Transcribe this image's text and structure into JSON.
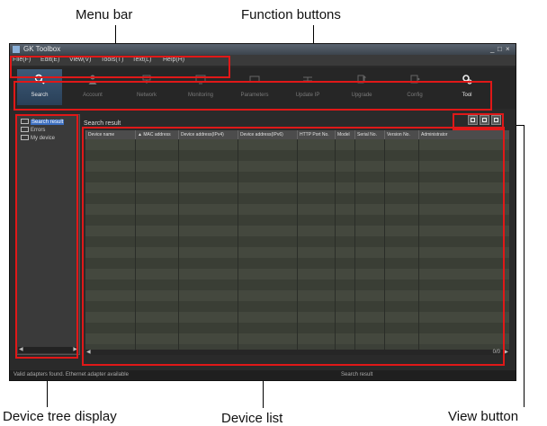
{
  "annotations": {
    "menu_bar": "Menu bar",
    "function_buttons": "Function buttons",
    "device_tree_display": "Device tree display",
    "device_list": "Device list",
    "view_button": "View button"
  },
  "window": {
    "title": "GK Toolbox"
  },
  "menu": {
    "items": [
      "File(F)",
      "Edit(E)",
      "View(V)",
      "Tools(T)",
      "Text(L)",
      "Help(H)"
    ]
  },
  "toolbar": {
    "buttons": [
      {
        "label": "Search",
        "icon": "search-icon",
        "state": "active"
      },
      {
        "label": "Account",
        "icon": "person-icon",
        "state": "disabled"
      },
      {
        "label": "Network",
        "icon": "network-icon",
        "state": "disabled"
      },
      {
        "label": "Monitoring",
        "icon": "monitor-icon",
        "state": "disabled"
      },
      {
        "label": "Parameters",
        "icon": "parameters-icon",
        "state": "disabled"
      },
      {
        "label": "Update IP",
        "icon": "ip-icon",
        "state": "disabled"
      },
      {
        "label": "Upgrade",
        "icon": "upgrade-icon",
        "state": "disabled"
      },
      {
        "label": "Config",
        "icon": "config-icon",
        "state": "disabled"
      },
      {
        "label": "Tool",
        "icon": "gear-icon",
        "state": "enabled"
      }
    ]
  },
  "tree": {
    "nodes": [
      {
        "label": "Search result",
        "selected": true
      },
      {
        "label": "Errors",
        "selected": false
      },
      {
        "label": "My device",
        "selected": false
      }
    ]
  },
  "list": {
    "title": "Search result",
    "columns": [
      "Device name",
      "▲ MAC address",
      "Device address(IPv4)",
      "Device address(IPv6)",
      "HTTP Port No.",
      "Model",
      "Serial No.",
      "Version No.",
      "Administrator"
    ],
    "row_count": 19,
    "page_indicator": "0/0"
  },
  "view_buttons": [
    {
      "icon": "list-view-icon"
    },
    {
      "icon": "detail-view-icon"
    },
    {
      "icon": "grid-view-icon"
    }
  ],
  "status": {
    "left": "Valid adapters found. Ethernet adapter available",
    "right": "Search result"
  },
  "colors": {
    "callout": "#e01818",
    "selection": "#3b6ec0"
  }
}
